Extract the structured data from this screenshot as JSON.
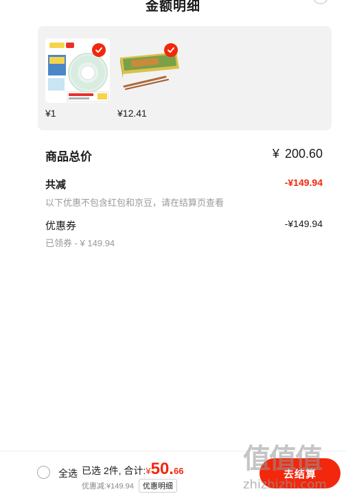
{
  "header": {
    "title": "金额明细",
    "close_icon": "close-icon"
  },
  "goods": [
    {
      "price": "¥1",
      "selected": true,
      "image": "tape-product-image"
    },
    {
      "price": "¥12.41",
      "selected": true,
      "image": "incense-box-product-image"
    }
  ],
  "breakdown": {
    "total_label": "商品总价",
    "total_currency": "¥",
    "total_value": "200.60",
    "reduce_label": "共减",
    "reduce_value": "-¥149.94",
    "reduce_note": "以下优惠不包含红包和京豆，请在结算页查看",
    "coupon_label": "优惠券",
    "coupon_value": "-¥149.94",
    "coupon_note": "已领券 - ¥ 149.94"
  },
  "footer": {
    "select_all": "全选",
    "selected_text": "已选 2件, 合计:",
    "total_currency": "¥",
    "total_int": "50.",
    "total_dec": "66",
    "discount_text": "优惠减:¥149.94",
    "detail_link": "优惠明细",
    "checkout": "去结算"
  },
  "watermark": {
    "logo": "值值值",
    "site": "zhizhizhi.com"
  },
  "colors": {
    "accent": "#f2270c",
    "panel_bg": "#f2f2f2",
    "muted_text": "#999999"
  }
}
